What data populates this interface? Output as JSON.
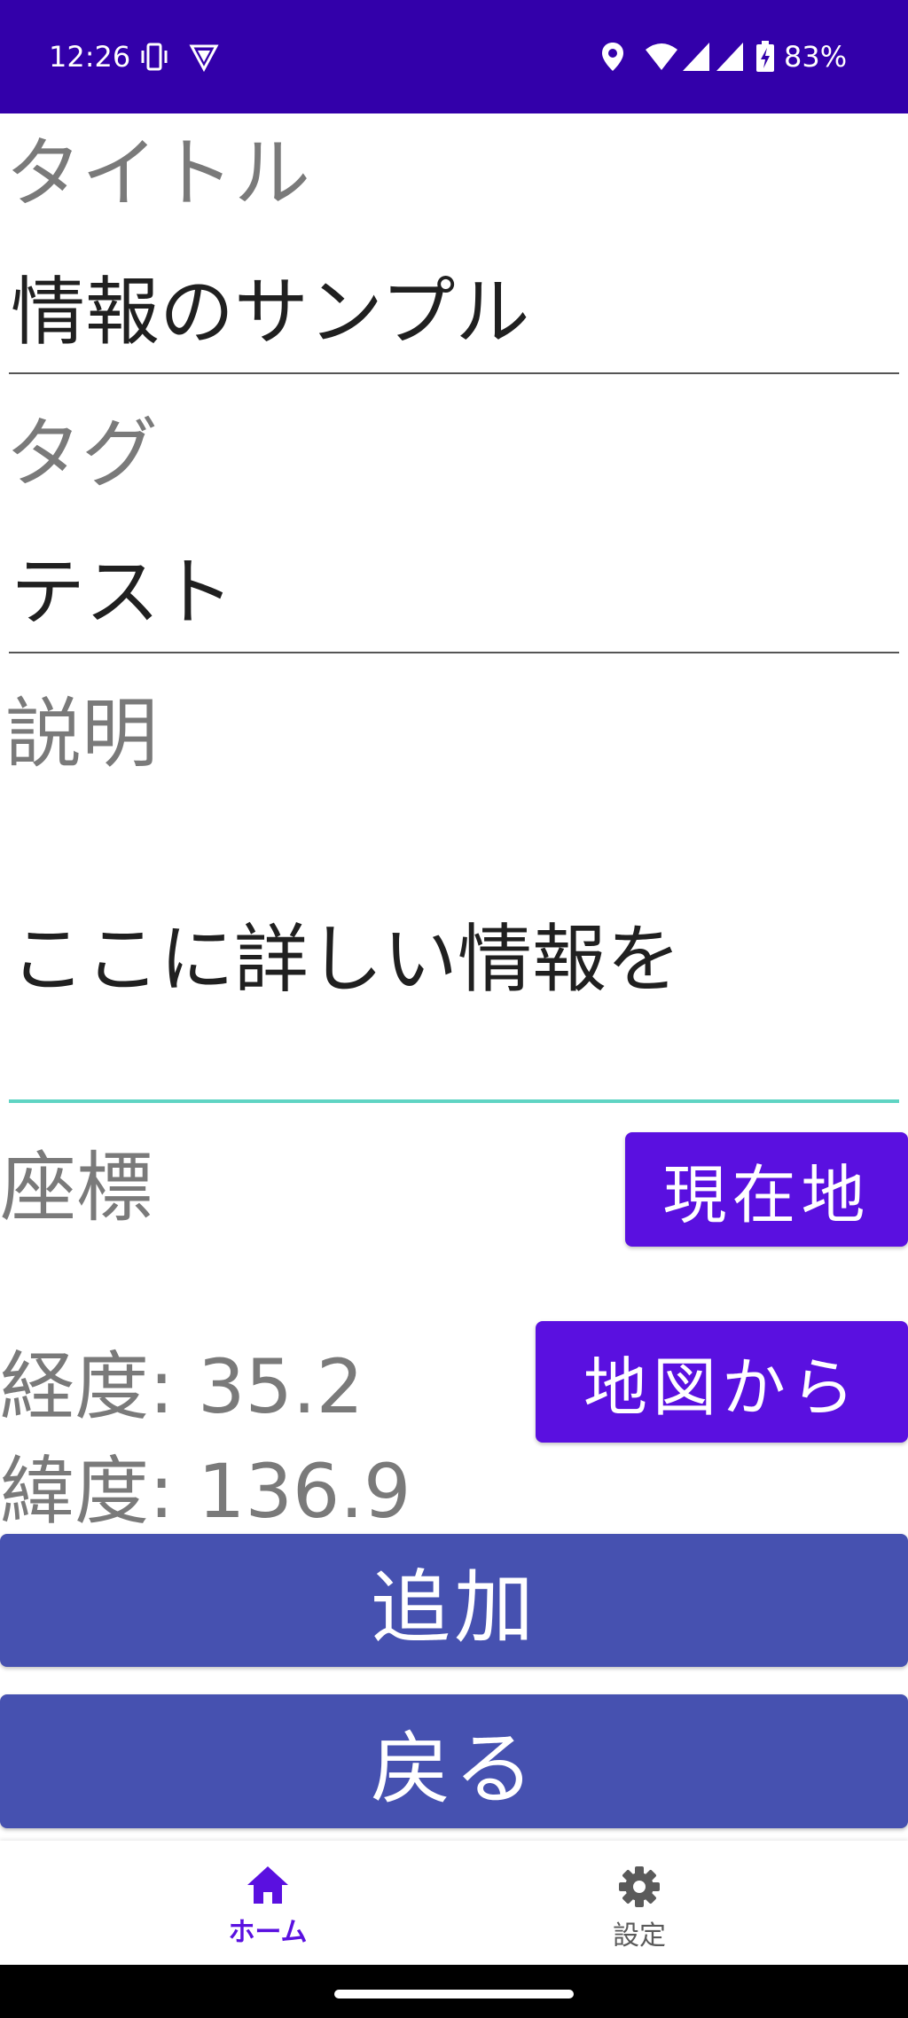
{
  "status_bar": {
    "time": "12:26",
    "battery": "83%",
    "icons": [
      "vibrate-icon",
      "vpn-shield-icon",
      "location-icon",
      "wifi-icon",
      "signal-icon",
      "signal-icon",
      "battery-charging-icon"
    ]
  },
  "form": {
    "title": {
      "label": "タイトル",
      "value": "情報のサンプル"
    },
    "tag": {
      "label": "タグ",
      "value": "テスト"
    },
    "description": {
      "label": "説明",
      "value": "ここに詳しい情報を"
    },
    "coordinates": {
      "label": "座標",
      "current_location_button": "現在地",
      "from_map_button": "地図から",
      "longitude_text": "経度: 35.2",
      "latitude_text": "緯度: 136.9"
    },
    "add_button": "追加",
    "back_button": "戻る"
  },
  "bottom_nav": {
    "items": [
      {
        "label": "ホーム",
        "icon": "home-icon",
        "active": true
      },
      {
        "label": "設定",
        "icon": "gear-icon",
        "active": false
      }
    ]
  },
  "colors": {
    "status_bar": "#3300aa",
    "accent_purple": "#5a10e0",
    "button_indigo": "#4651b0",
    "focus_underline": "#5fd4c3"
  }
}
